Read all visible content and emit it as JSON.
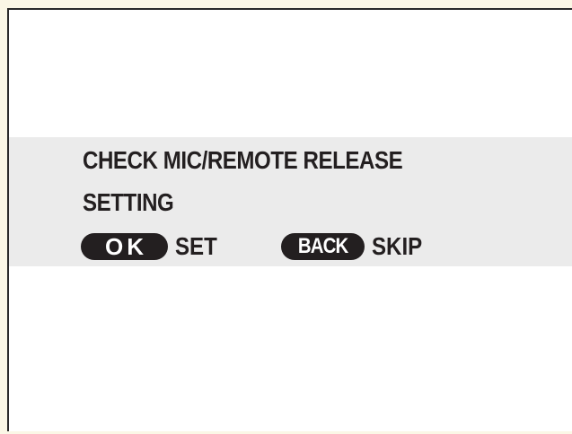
{
  "dialog": {
    "message_line_1": "CHECK MIC/REMOTE RELEASE",
    "message_line_2": "SETTING"
  },
  "actions": {
    "ok": {
      "key_label": "OK",
      "action_label": "SET"
    },
    "back": {
      "key_label": "BACK",
      "action_label": "SKIP"
    }
  },
  "colors": {
    "outer_background": "#fbf7e6",
    "screen_background": "#ffffff",
    "band_background": "#ebebeb",
    "text": "#231f20",
    "key_pill": "#231f20",
    "key_text": "#ffffff"
  }
}
